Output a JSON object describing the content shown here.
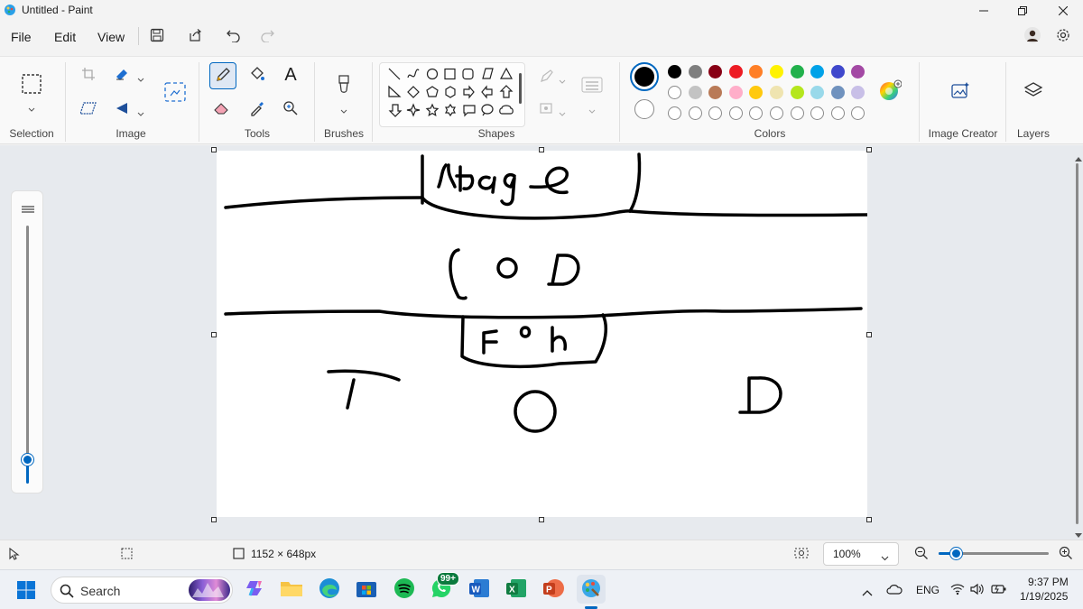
{
  "window": {
    "title": "Untitled - Paint",
    "minimize_icon": "minimize-icon",
    "maximize_icon": "restore-icon",
    "close_icon": "close-icon"
  },
  "menu": {
    "items": [
      "File",
      "Edit",
      "View"
    ],
    "quick_actions": [
      "save-icon",
      "share-icon",
      "undo-icon",
      "redo-icon"
    ]
  },
  "ribbon": {
    "groups": {
      "selection": "Selection",
      "image": "Image",
      "tools": "Tools",
      "brushes": "Brushes",
      "shapes": "Shapes",
      "colors": "Colors",
      "image_creator": "Image Creator",
      "layers": "Layers"
    },
    "active_tool": "pencil",
    "primary_color": "#000000",
    "secondary_color": "#ffffff",
    "palette_row1": [
      "#000000",
      "#7f7f7f",
      "#880015",
      "#ed1c24",
      "#ff7f27",
      "#fff200",
      "#22b14c",
      "#00a2e8",
      "#3f48cc",
      "#a349a4"
    ],
    "palette_row2": [
      "#ffffff",
      "#c3c3c3",
      "#b97a57",
      "#ffaec9",
      "#ffc90e",
      "#efe4b0",
      "#b5e61d",
      "#99d9ea",
      "#7092be",
      "#c8bfe7"
    ]
  },
  "canvas": {
    "drawing_labels": [
      "stage",
      "S O D",
      "FOH",
      "T",
      "O",
      "D"
    ]
  },
  "status": {
    "canvas_size": "1152 × 648px",
    "zoom": "100%"
  },
  "taskbar": {
    "search_placeholder": "Search",
    "whatsapp_badge": "99+",
    "language": "ENG",
    "time": "9:37 PM",
    "date": "1/19/2025"
  }
}
